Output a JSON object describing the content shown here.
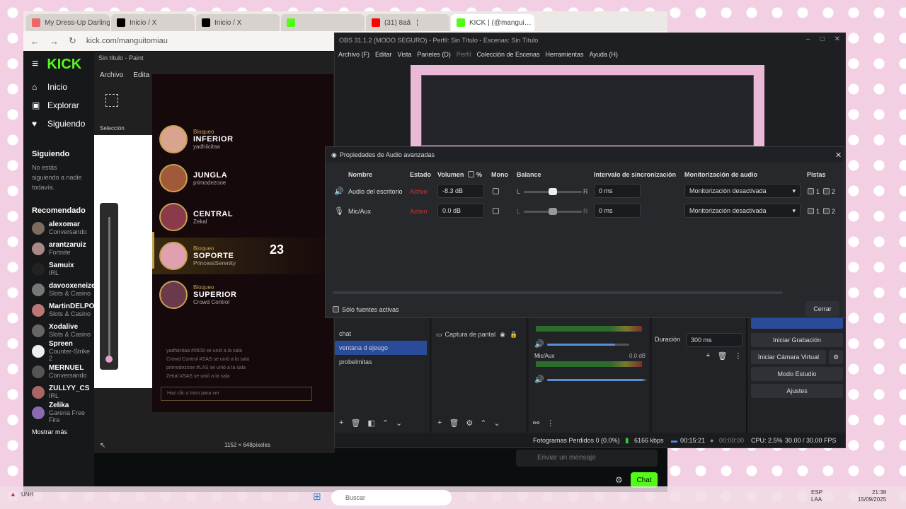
{
  "browser": {
    "tabs": [
      "My Dress-Up Darling",
      "Inicio / X",
      "Inicio / X",
      "",
      "(31) 8aâ¦",
      "KICK | (@mangui…"
    ],
    "url": "kick.com/manguitomiau"
  },
  "kick": {
    "logo": "KICK",
    "nav": [
      {
        "icon": "home-icon",
        "label": "Inicio"
      },
      {
        "icon": "explore-icon",
        "label": "Explorar"
      },
      {
        "icon": "heart-icon",
        "label": "Siguiendo"
      }
    ],
    "following_title": "Siguiendo",
    "following_empty": "No estás siguiendo a nadie todavía.",
    "recommended_title": "Recomendado",
    "recommended": [
      {
        "name": "alexomar",
        "game": "Conversando",
        "color": "#7d6b5d"
      },
      {
        "name": "arantzaruiz",
        "game": "Fortnite",
        "color": "#a88"
      },
      {
        "name": "Samuix",
        "game": "IRL",
        "color": "#222"
      },
      {
        "name": "davooxeneize",
        "game": "Slots & Casino",
        "color": "#777"
      },
      {
        "name": "MartinDELPOI",
        "game": "Slots & Casino",
        "color": "#b77"
      },
      {
        "name": "Xodalive",
        "game": "Slots & Casino",
        "color": "#666"
      },
      {
        "name": "Spreen",
        "game": "Counter-Strike 2",
        "color": "#eee"
      },
      {
        "name": "MERNUEL",
        "game": "Conversando",
        "color": "#555"
      },
      {
        "name": "ZULLYY_CS",
        "game": "IRL",
        "color": "#a66"
      },
      {
        "name": "Zelika",
        "game": "Garena Free Fire",
        "color": "#8a6bb0"
      }
    ],
    "show_more": "Mostrar más",
    "chat_placeholder": "Enviar un mensaje",
    "chat_button": "Chat"
  },
  "paint": {
    "title": "Sin título - Paint",
    "menu": [
      "Archivo",
      "Edita"
    ],
    "selection_label": "Selección",
    "dimensions": "1152 × 648píxeles"
  },
  "game": {
    "roles": [
      {
        "block": "Bloqueo",
        "role": "INFERIOR",
        "player": "yadhiicitaa"
      },
      {
        "block": "",
        "role": "JUNGLA",
        "player": "primodezooe"
      },
      {
        "block": "",
        "role": "CENTRAL",
        "player": "Zekal"
      },
      {
        "block": "Bloqueo",
        "role": "SOPORTE",
        "player": "PrincessSerenity"
      },
      {
        "block": "Bloqueo",
        "role": "SUPERIOR",
        "player": "Crowd Control"
      }
    ],
    "timer": "23",
    "chat": [
      "yadhiicitaa #0609 se unió a la sala",
      "Crowd Control #SAS se unió a la sala",
      "primodezooe #LAS se unió a la sala",
      "Zekal #SAS se unió a la sala"
    ],
    "chat_input": "Haz clic o Intro para ver"
  },
  "obs": {
    "title": "OBS 31.1.2 (MODO SEGURO) - Perfil: Sin Título - Escenas: Sin Título",
    "menu": [
      "Archivo (F)",
      "Editar",
      "Vista",
      "Paneles (D)",
      "Perfil",
      "Colección de Escenas",
      "Herramientas",
      "Ayuda (H)"
    ],
    "scenes": [
      "chat",
      "ventana d ejeugo",
      "probelmitas"
    ],
    "source": "Captura de pantal",
    "mic_label": "Mic/Aux",
    "mic_db": "0.0 dB",
    "duration_label": "Duración",
    "duration_value": "300 ms",
    "controls": [
      "Iniciar Grabación",
      "Iniciar Cámara Virtual",
      "Modo Estudio",
      "Ajustes"
    ],
    "status": {
      "dropped": "Fotogramas Perdidos 0 (0.0%)",
      "kbps": "6166 kbps",
      "live": "00:15:21",
      "rec": "00:00:00",
      "cpu": "CPU: 2.5%",
      "fps": "30.00 / 30.00 FPS"
    }
  },
  "dialog": {
    "title": "Propiedades de Audio avanzadas",
    "headers": [
      "Nombre",
      "Estado",
      "Volumen",
      "%",
      "Mono",
      "Balance",
      "Intervalo de sincronización",
      "Monitorización de audio",
      "Pistas"
    ],
    "rows": [
      {
        "name": "Audio del escritorio",
        "state": "Activo",
        "volume": "-8.3 dB",
        "balance": 0.5,
        "sync": "0 ms",
        "monitor": "Monitorización desactivada",
        "t1": "1",
        "t2": "2"
      },
      {
        "name": "Mic/Aux",
        "state": "Activo",
        "volume": "0.0 dB",
        "balance": 0.5,
        "sync": "0 ms",
        "monitor": "Monitorización desactivada",
        "t1": "1",
        "t2": "2"
      }
    ],
    "balance_l": "L",
    "balance_r": "R",
    "active_only": "Sólo fuentes activas",
    "close": "Cerrar"
  },
  "taskbar": {
    "search": "Buscar",
    "weather": "UNH",
    "lang1": "ESP",
    "lang2": "LAA",
    "time": "21:38",
    "date": "15/09/2025"
  }
}
